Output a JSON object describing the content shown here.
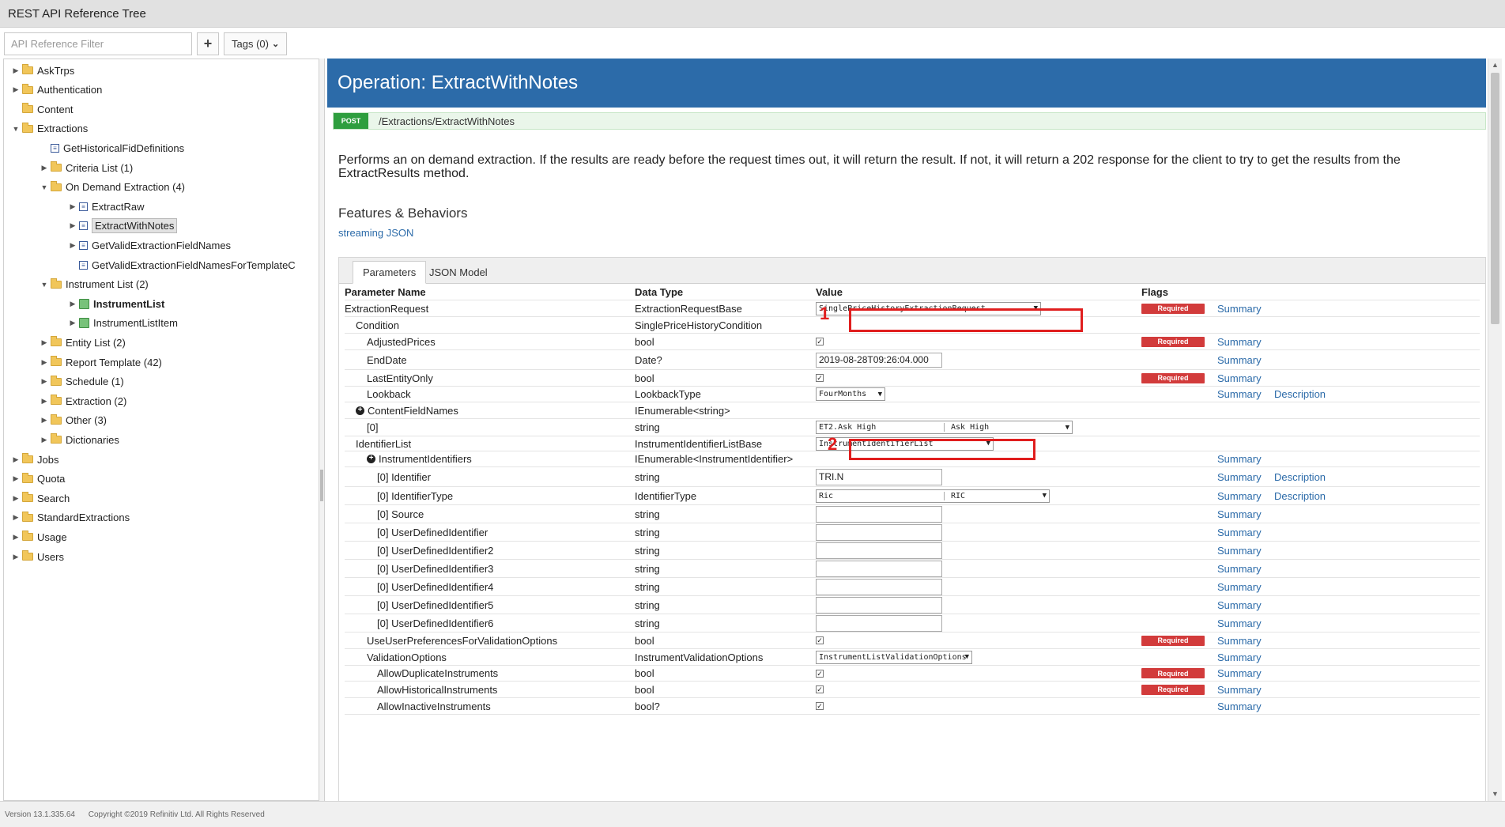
{
  "app_title": "REST API Reference Tree",
  "toolbar": {
    "filter_placeholder": "API Reference Filter",
    "add_label": "+",
    "tags_label": "Tags (0)"
  },
  "tree": [
    {
      "label": "AskTrps",
      "icon": "folder",
      "expand": "collapsed"
    },
    {
      "label": "Authentication",
      "icon": "folder",
      "expand": "collapsed"
    },
    {
      "label": "Content",
      "icon": "folder",
      "expand": "none"
    },
    {
      "label": "Extractions",
      "icon": "folder",
      "expand": "expanded"
    },
    {
      "label": "GetHistoricalFidDefinitions",
      "icon": "operation",
      "expand": "none"
    },
    {
      "label": "Criteria List (1)",
      "icon": "folder",
      "expand": "collapsed"
    },
    {
      "label": "On Demand Extraction (4)",
      "icon": "folder",
      "expand": "expanded"
    },
    {
      "label": "ExtractRaw",
      "icon": "operation",
      "expand": "collapsed"
    },
    {
      "label": "ExtractWithNotes",
      "icon": "operation",
      "expand": "collapsed",
      "selected": true
    },
    {
      "label": "GetValidExtractionFieldNames",
      "icon": "operation",
      "expand": "collapsed"
    },
    {
      "label": "GetValidExtractionFieldNamesForTemplateC",
      "icon": "operation",
      "expand": "none"
    },
    {
      "label": "Instrument List (2)",
      "icon": "folder",
      "expand": "expanded"
    },
    {
      "label": "InstrumentList",
      "icon": "entity",
      "expand": "collapsed",
      "bold": true
    },
    {
      "label": "InstrumentListItem",
      "icon": "entity",
      "expand": "collapsed"
    },
    {
      "label": "Entity List (2)",
      "icon": "folder",
      "expand": "collapsed"
    },
    {
      "label": "Report Template (42)",
      "icon": "folder",
      "expand": "collapsed"
    },
    {
      "label": "Schedule (1)",
      "icon": "folder",
      "expand": "collapsed"
    },
    {
      "label": "Extraction (2)",
      "icon": "folder",
      "expand": "collapsed"
    },
    {
      "label": "Other (3)",
      "icon": "folder",
      "expand": "collapsed"
    },
    {
      "label": "Dictionaries",
      "icon": "folder",
      "expand": "collapsed"
    },
    {
      "label": "Jobs",
      "icon": "folder",
      "expand": "collapsed"
    },
    {
      "label": "Quota",
      "icon": "folder",
      "expand": "collapsed"
    },
    {
      "label": "Search",
      "icon": "folder",
      "expand": "collapsed"
    },
    {
      "label": "StandardExtractions",
      "icon": "folder",
      "expand": "collapsed"
    },
    {
      "label": "Usage",
      "icon": "folder",
      "expand": "collapsed"
    },
    {
      "label": "Users",
      "icon": "folder",
      "expand": "collapsed"
    }
  ],
  "operation": {
    "title": "Operation: ExtractWithNotes",
    "method": "POST",
    "path": "/Extractions/ExtractWithNotes",
    "description": "Performs an on demand extraction. If the results are ready before the request times out, it will return the result. If not, it will return a 202 response for the client to try to get the results from the ExtractResults method.",
    "features_title": "Features & Behaviors",
    "features_link": "streaming JSON"
  },
  "tabs": [
    "Parameters",
    "JSON Model"
  ],
  "columns": {
    "name": "Parameter Name",
    "type": "Data Type",
    "value": "Value",
    "flags": "Flags"
  },
  "labels": {
    "required": "Required",
    "summary": "Summary",
    "description": "Description"
  },
  "callouts": [
    "1",
    "2"
  ],
  "rows": [
    {
      "name": "ExtractionRequest",
      "level": 0,
      "type": "ExtractionRequestBase",
      "value_kind": "select",
      "value": "SinglePriceHistoryExtractionRequest",
      "required": true,
      "summary": true,
      "description": false
    },
    {
      "name": "Condition",
      "level": 1,
      "type": "SinglePriceHistoryCondition",
      "value_kind": "none",
      "required": false,
      "summary": false,
      "description": false
    },
    {
      "name": "AdjustedPrices",
      "level": 2,
      "type": "bool",
      "value_kind": "checkbox",
      "required": true,
      "summary": true,
      "description": false
    },
    {
      "name": "EndDate",
      "level": 2,
      "type": "Date?",
      "value_kind": "text",
      "value": "2019-08-28T09:26:04.000",
      "required": false,
      "summary": true,
      "description": false
    },
    {
      "name": "LastEntityOnly",
      "level": 2,
      "type": "bool",
      "value_kind": "checkbox",
      "required": true,
      "summary": true,
      "description": false
    },
    {
      "name": "Lookback",
      "level": 2,
      "type": "LookbackType",
      "value_kind": "select",
      "value": "FourMonths",
      "required": false,
      "summary": true,
      "description": true
    },
    {
      "name": "ContentFieldNames",
      "level": 1,
      "type": "IEnumerable<string>",
      "value_kind": "none",
      "plus": true,
      "required": false,
      "summary": false,
      "description": false
    },
    {
      "name": "[0]",
      "level": 2,
      "type": "string",
      "value_kind": "select",
      "value": "ET2.Ask High",
      "value2": "Ask High",
      "required": false,
      "summary": false,
      "description": false
    },
    {
      "name": "IdentifierList",
      "level": 1,
      "type": "InstrumentIdentifierListBase",
      "value_kind": "select",
      "value": "InstrumentIdentifierList",
      "required": false,
      "summary": false,
      "description": false
    },
    {
      "name": "InstrumentIdentifiers",
      "level": 2,
      "type": "IEnumerable<InstrumentIdentifier>",
      "value_kind": "none",
      "plus": true,
      "required": false,
      "summary": true,
      "description": false
    },
    {
      "name": "[0] Identifier",
      "level": 3,
      "type": "string",
      "value_kind": "text",
      "value": "TRI.N",
      "required": false,
      "summary": true,
      "description": true
    },
    {
      "name": "[0] IdentifierType",
      "level": 3,
      "type": "IdentifierType",
      "value_kind": "select",
      "value": "Ric",
      "value2": "RIC",
      "required": false,
      "summary": true,
      "description": true
    },
    {
      "name": "[0] Source",
      "level": 3,
      "type": "string",
      "value_kind": "text",
      "value": "",
      "required": false,
      "summary": true,
      "description": false
    },
    {
      "name": "[0] UserDefinedIdentifier",
      "level": 3,
      "type": "string",
      "value_kind": "text",
      "value": "",
      "required": false,
      "summary": true,
      "description": false
    },
    {
      "name": "[0] UserDefinedIdentifier2",
      "level": 3,
      "type": "string",
      "value_kind": "text",
      "value": "",
      "required": false,
      "summary": true,
      "description": false
    },
    {
      "name": "[0] UserDefinedIdentifier3",
      "level": 3,
      "type": "string",
      "value_kind": "text",
      "value": "",
      "required": false,
      "summary": true,
      "description": false
    },
    {
      "name": "[0] UserDefinedIdentifier4",
      "level": 3,
      "type": "string",
      "value_kind": "text",
      "value": "",
      "required": false,
      "summary": true,
      "description": false
    },
    {
      "name": "[0] UserDefinedIdentifier5",
      "level": 3,
      "type": "string",
      "value_kind": "text",
      "value": "",
      "required": false,
      "summary": true,
      "description": false
    },
    {
      "name": "[0] UserDefinedIdentifier6",
      "level": 3,
      "type": "string",
      "value_kind": "text",
      "value": "",
      "required": false,
      "summary": true,
      "description": false
    },
    {
      "name": "UseUserPreferencesForValidationOptions",
      "level": 2,
      "type": "bool",
      "value_kind": "checkbox",
      "required": true,
      "summary": true,
      "description": false
    },
    {
      "name": "ValidationOptions",
      "level": 2,
      "type": "InstrumentValidationOptions",
      "value_kind": "select",
      "value": "InstrumentListValidationOptions",
      "required": false,
      "summary": true,
      "description": false
    },
    {
      "name": "AllowDuplicateInstruments",
      "level": 3,
      "type": "bool",
      "value_kind": "checkbox",
      "required": true,
      "summary": true,
      "description": false
    },
    {
      "name": "AllowHistoricalInstruments",
      "level": 3,
      "type": "bool",
      "value_kind": "checkbox",
      "required": true,
      "summary": true,
      "description": false
    },
    {
      "name": "AllowInactiveInstruments",
      "level": 3,
      "type": "bool?",
      "value_kind": "checkbox",
      "required": false,
      "summary": true,
      "description": false
    }
  ],
  "footer": {
    "version": "Version 13.1.335.64",
    "copyright": "Copyright ©2019 Refinitiv Ltd. All Rights Reserved"
  }
}
